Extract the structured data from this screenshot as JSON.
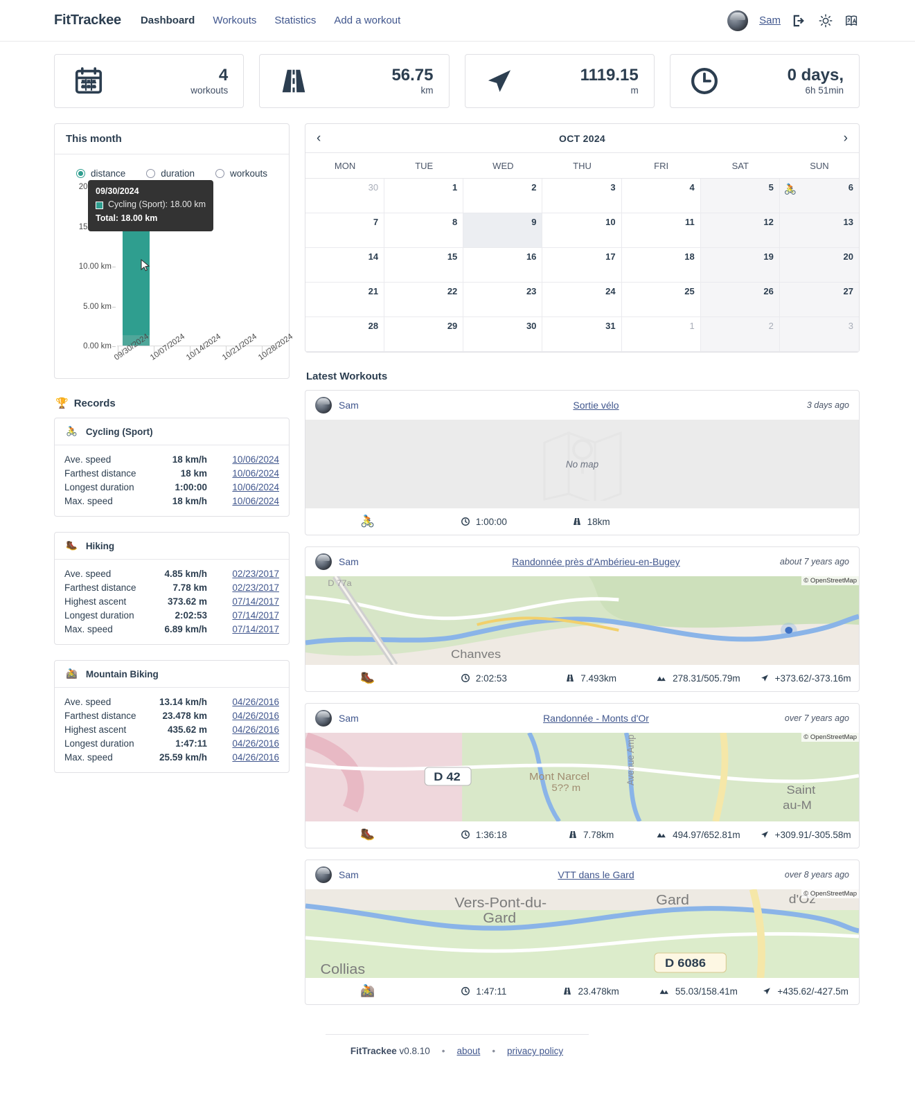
{
  "header": {
    "brand": "FitTrackee",
    "nav": [
      {
        "label": "Dashboard",
        "active": true
      },
      {
        "label": "Workouts",
        "active": false
      },
      {
        "label": "Statistics",
        "active": false
      },
      {
        "label": "Add a workout",
        "active": false
      }
    ],
    "username": "Sam",
    "icons": [
      "logout-icon",
      "light-mode-icon",
      "language-icon"
    ]
  },
  "stats": [
    {
      "icon": "calendar-icon",
      "value": "4",
      "unit": "workouts"
    },
    {
      "icon": "road-icon",
      "value": "56.75",
      "unit": "km"
    },
    {
      "icon": "navigation-arrow-icon",
      "value": "1119.15",
      "unit": "m"
    },
    {
      "icon": "clock-icon",
      "value": "0 days,",
      "unit": "6h 51min"
    }
  ],
  "chart_card": {
    "title": "This month",
    "options": [
      {
        "label": "distance",
        "selected": true
      },
      {
        "label": "duration",
        "selected": false
      },
      {
        "label": "workouts",
        "selected": false
      }
    ],
    "tooltip": {
      "date": "09/30/2024",
      "series_line": "Cycling (Sport): 18.00 km",
      "total_line": "Total: 18.00 km",
      "swatch_color": "#2f9e8f"
    },
    "bar_label": "18.00 km"
  },
  "chart_data": {
    "type": "bar",
    "title": "This month",
    "categories": [
      "09/30/2024",
      "10/07/2024",
      "10/14/2024",
      "10/21/2024",
      "10/28/2024"
    ],
    "series": [
      {
        "name": "Cycling (Sport)",
        "color": "#2f9e8f",
        "values": [
          18.0,
          0,
          0,
          0,
          0
        ]
      }
    ],
    "values": [
      18.0,
      0,
      0,
      0,
      0
    ],
    "yticks": [
      "0.00 km",
      "5.00 km",
      "10.00 km",
      "15.00 km",
      "20.00 km"
    ],
    "ylim": [
      0,
      20
    ],
    "ylabel": "",
    "xlabel": "",
    "grid": false,
    "legend": "none",
    "unit": "km"
  },
  "records": {
    "title": "Records",
    "icon": "trophy-icon",
    "cards": [
      {
        "sport": "Cycling (Sport)",
        "icon": "cycling-icon",
        "rows": [
          {
            "label": "Ave. speed",
            "value": "18 km/h",
            "date": "10/06/2024"
          },
          {
            "label": "Farthest distance",
            "value": "18 km",
            "date": "10/06/2024"
          },
          {
            "label": "Longest duration",
            "value": "1:00:00",
            "date": "10/06/2024"
          },
          {
            "label": "Max. speed",
            "value": "18 km/h",
            "date": "10/06/2024"
          }
        ]
      },
      {
        "sport": "Hiking",
        "icon": "hiking-icon",
        "rows": [
          {
            "label": "Ave. speed",
            "value": "4.85 km/h",
            "date": "02/23/2017"
          },
          {
            "label": "Farthest distance",
            "value": "7.78 km",
            "date": "02/23/2017"
          },
          {
            "label": "Highest ascent",
            "value": "373.62 m",
            "date": "07/14/2017"
          },
          {
            "label": "Longest duration",
            "value": "2:02:53",
            "date": "07/14/2017"
          },
          {
            "label": "Max. speed",
            "value": "6.89 km/h",
            "date": "07/14/2017"
          }
        ]
      },
      {
        "sport": "Mountain Biking",
        "icon": "mountain-biking-icon",
        "rows": [
          {
            "label": "Ave. speed",
            "value": "13.14 km/h",
            "date": "04/26/2016"
          },
          {
            "label": "Farthest distance",
            "value": "23.478 km",
            "date": "04/26/2016"
          },
          {
            "label": "Highest ascent",
            "value": "435.62 m",
            "date": "04/26/2016"
          },
          {
            "label": "Longest duration",
            "value": "1:47:11",
            "date": "04/26/2016"
          },
          {
            "label": "Max. speed",
            "value": "25.59 km/h",
            "date": "04/26/2016"
          }
        ]
      }
    ]
  },
  "calendar": {
    "title": "OCT 2024",
    "prev": "‹",
    "next": "›",
    "dow": [
      "MON",
      "TUE",
      "WED",
      "THU",
      "FRI",
      "SAT",
      "SUN"
    ],
    "days": [
      {
        "n": "30",
        "out": true
      },
      {
        "n": "1"
      },
      {
        "n": "2"
      },
      {
        "n": "3"
      },
      {
        "n": "4"
      },
      {
        "n": "5",
        "weekend": true
      },
      {
        "n": "6",
        "weekend": true,
        "workout": "🚴"
      },
      {
        "n": "7"
      },
      {
        "n": "8"
      },
      {
        "n": "9",
        "today": true
      },
      {
        "n": "10"
      },
      {
        "n": "11"
      },
      {
        "n": "12",
        "weekend": true
      },
      {
        "n": "13",
        "weekend": true
      },
      {
        "n": "14"
      },
      {
        "n": "15"
      },
      {
        "n": "16"
      },
      {
        "n": "17"
      },
      {
        "n": "18"
      },
      {
        "n": "19",
        "weekend": true
      },
      {
        "n": "20",
        "weekend": true
      },
      {
        "n": "21"
      },
      {
        "n": "22"
      },
      {
        "n": "23"
      },
      {
        "n": "24"
      },
      {
        "n": "25"
      },
      {
        "n": "26",
        "weekend": true
      },
      {
        "n": "27",
        "weekend": true
      },
      {
        "n": "28"
      },
      {
        "n": "29"
      },
      {
        "n": "30"
      },
      {
        "n": "31"
      },
      {
        "n": "1",
        "out": true
      },
      {
        "n": "2",
        "out": true,
        "weekend": true
      },
      {
        "n": "3",
        "out": true,
        "weekend": true
      }
    ]
  },
  "latest_workouts": {
    "title": "Latest Workouts",
    "items": [
      {
        "user": "Sam",
        "title": "Sortie vélo",
        "ago": "3 days ago",
        "map": "none",
        "map_text": "No map",
        "sport_icon": "cycling-icon",
        "stats": [
          {
            "icon": "clock-icon",
            "value": "1:00:00"
          },
          {
            "icon": "road-icon",
            "value": "18km"
          }
        ]
      },
      {
        "user": "Sam",
        "title": "Randonnée près d'Ambérieu-en-Bugey",
        "ago": "about 7 years ago",
        "map": "map1",
        "attribution": "© OpenStreetMap",
        "sport_icon": "hiking-icon",
        "stats": [
          {
            "icon": "clock-icon",
            "value": "2:02:53"
          },
          {
            "icon": "road-icon",
            "value": "7.493km"
          },
          {
            "icon": "elevation-icon",
            "value": "278.31/505.79m"
          },
          {
            "icon": "ascent-descent-icon",
            "value": "+373.62/-373.16m"
          }
        ]
      },
      {
        "user": "Sam",
        "title": "Randonnée - Monts d'Or",
        "ago": "over 7 years ago",
        "map": "map2",
        "attribution": "© OpenStreetMap",
        "sport_icon": "hiking-icon",
        "stats": [
          {
            "icon": "clock-icon",
            "value": "1:36:18"
          },
          {
            "icon": "road-icon",
            "value": "7.78km"
          },
          {
            "icon": "elevation-icon",
            "value": "494.97/652.81m"
          },
          {
            "icon": "ascent-descent-icon",
            "value": "+309.91/-305.58m"
          }
        ]
      },
      {
        "user": "Sam",
        "title": "VTT dans le Gard",
        "ago": "over 8 years ago",
        "map": "map3",
        "attribution": "© OpenStreetMap",
        "sport_icon": "mountain-biking-icon",
        "stats": [
          {
            "icon": "clock-icon",
            "value": "1:47:11"
          },
          {
            "icon": "road-icon",
            "value": "23.478km"
          },
          {
            "icon": "elevation-icon",
            "value": "55.03/158.41m"
          },
          {
            "icon": "ascent-descent-icon",
            "value": "+435.62/-427.5m"
          }
        ]
      }
    ]
  },
  "footer": {
    "brand": "FitTrackee",
    "version": "v0.8.10",
    "sep": "•",
    "about": "about",
    "privacy": "privacy policy"
  }
}
